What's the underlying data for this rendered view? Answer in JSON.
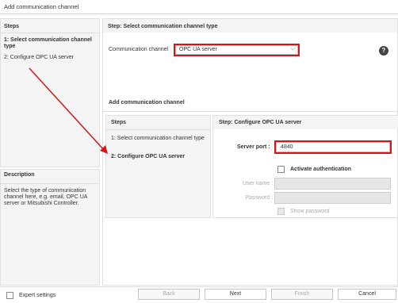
{
  "window": {
    "title": "Add communication channel"
  },
  "outer": {
    "steps_header": "Steps",
    "steps": [
      {
        "label": "1: Select communication channel type",
        "active": true
      },
      {
        "label": "2: Configure OPC UA server",
        "active": false
      }
    ],
    "step_header": "Step: Select communication channel type",
    "channel_label": "Communication channel",
    "channel_value": "OPC UA server",
    "description_header": "Description",
    "description_text": "Select the type of communication channel here, e.g. email, OPC UA server or Mitsubishi Controller."
  },
  "inner": {
    "title": "Add communication channel",
    "steps_header": "Steps",
    "steps": [
      {
        "label": "1: Select communication channel type",
        "active": false
      },
      {
        "label": "2: Configure OPC UA server",
        "active": true
      }
    ],
    "step_header": "Step: Configure OPC UA server",
    "server_port_label": "Server port :",
    "server_port_value": "4840",
    "activate_auth_label": "Activate authentication",
    "user_name_label": "User name :",
    "password_label": "Password :",
    "show_password_label": "Show password"
  },
  "footer": {
    "expert_settings_label": "Expert settings",
    "back_label": "Back",
    "next_label": "Next",
    "finish_label": "Finish",
    "cancel_label": "Cancel"
  },
  "colors": {
    "highlight": "#d01818",
    "panel": "#f4f4f4"
  },
  "icons": {
    "help": "help-icon",
    "dropdown": "chevron-down-icon",
    "arrow": "arrow-annotation"
  }
}
